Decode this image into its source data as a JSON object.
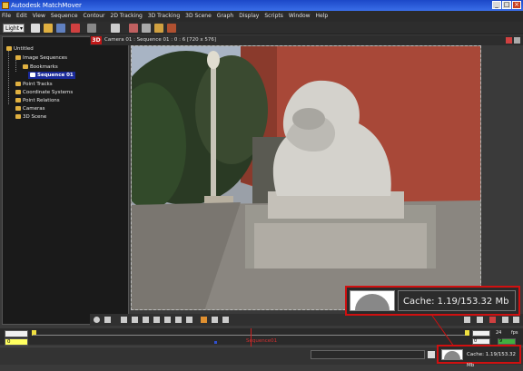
{
  "window": {
    "title": "Autodesk MatchMover"
  },
  "menu": [
    "File",
    "Edit",
    "View",
    "Sequence",
    "Contour",
    "2D Tracking",
    "3D Tracking",
    "3D Scene",
    "Graph",
    "Display",
    "Scripts",
    "Window",
    "Help"
  ],
  "toolbar": {
    "mode_select": "Light"
  },
  "tree": {
    "root": "Untitled",
    "image_sequences": "Image Sequences",
    "bookmarks": "Bookmarks",
    "sequence": "Sequence 01",
    "point_tracks": "Point Tracks",
    "coordinate_systems": "Coordinate Systems",
    "point_relations": "Point Relations",
    "cameras": "Cameras",
    "scene_3d": "3D Scene"
  },
  "viewer": {
    "badge": "3D",
    "info": "Camera 01 : Sequence 01 : 0 : 6 [720 x 576]"
  },
  "timeline": {
    "start_frame": "0",
    "current_frame": "0",
    "end_frame": "24",
    "fps_label": "fps",
    "right_value": "9",
    "marker_label": "Sequence01"
  },
  "cache": {
    "text": "Cache: 1.19/153.32 Mb"
  },
  "colors": {
    "accent_red": "#d01010",
    "selection_blue": "#1a2a9a",
    "folder_yellow": "#e0b040"
  }
}
